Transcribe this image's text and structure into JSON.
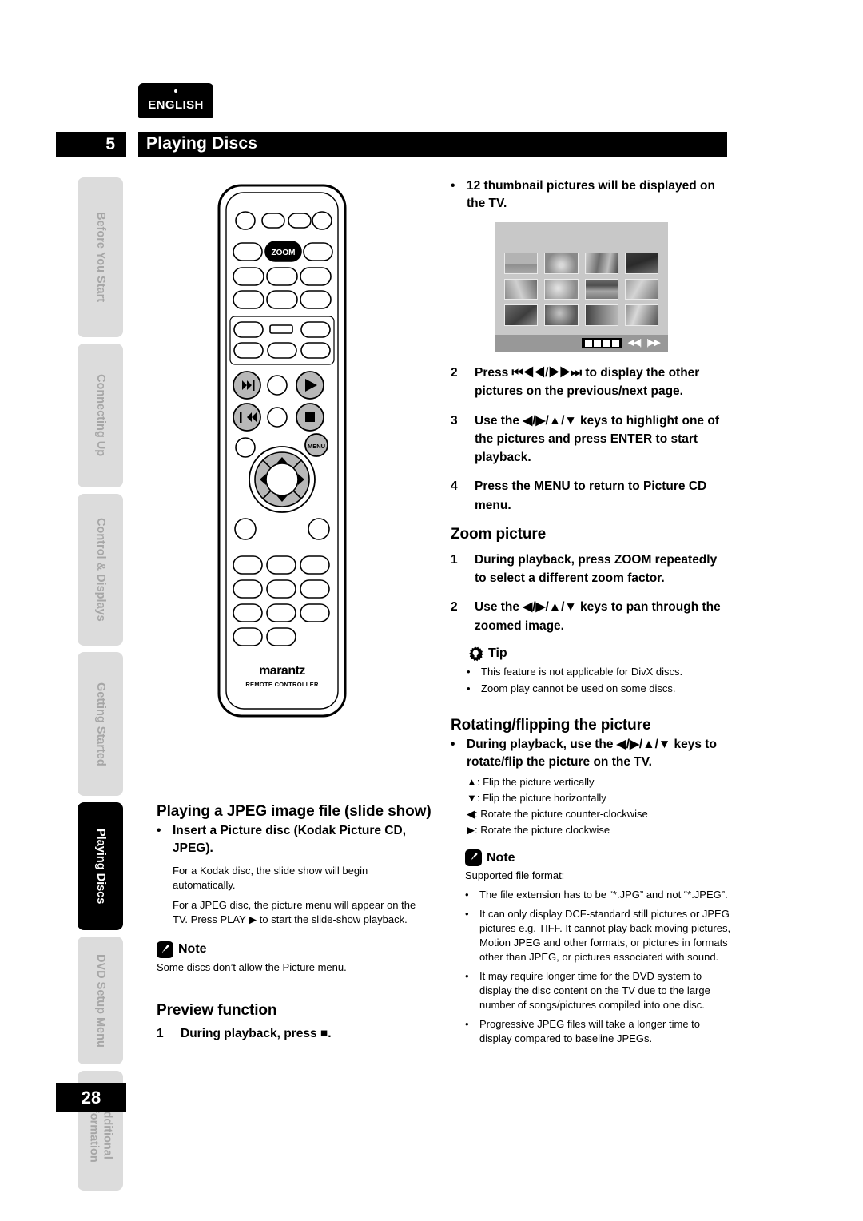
{
  "lang_tab": {
    "label": "ENGLISH"
  },
  "header": {
    "number": "5",
    "title": "Playing Discs"
  },
  "page_number": "28",
  "sidebar": {
    "items": [
      {
        "label": "Before You Start",
        "active": false
      },
      {
        "label": "Connecting Up",
        "active": false
      },
      {
        "label": "Control & Displays",
        "active": false
      },
      {
        "label": "Getting Started",
        "active": false
      },
      {
        "label": "Playing Discs",
        "active": true
      },
      {
        "label": "DVD Setup Menu",
        "active": false
      },
      {
        "label": "Additional\nInformation",
        "active": false
      }
    ]
  },
  "remote": {
    "zoom_button_label": "ZOOM",
    "menu_button_label": "MENU",
    "brand": "marantz",
    "subtitle": "REMOTE CONTROLLER"
  },
  "tv_screen": {
    "thumbnail_count": 12,
    "prev_icon": "skip-previous-icon",
    "next_icon": "skip-next-icon",
    "filmstrip_icon": "filmstrip-icon"
  },
  "left_column": {
    "jpeg_section": {
      "heading": "Playing a JPEG image file (slide show)",
      "bullet": "Insert a Picture disc (Kodak Picture CD, JPEG).",
      "para1": "For a Kodak disc, the slide show will begin automatically.",
      "para2": "For a JPEG disc, the picture menu will appear on the TV. Press PLAY ▶ to start the slide-show playback."
    },
    "note": {
      "label": "Note",
      "body": "Some discs don’t allow the Picture menu."
    },
    "preview_section": {
      "heading": "Preview function",
      "step_num": "1",
      "step_text": "During playback, press ■."
    }
  },
  "right_column": {
    "intro_bullet": "12 thumbnail pictures will be displayed on the TV.",
    "steps": [
      {
        "num": "2",
        "text": "Press ⏮◀◀/▶▶⏭ to display the other pictures on the previous/next page."
      },
      {
        "num": "3",
        "text": "Use the ◀/▶/▲/▼ keys to highlight one of the pictures and press ENTER to start playback."
      },
      {
        "num": "4",
        "text": "Press the MENU to return to Picture CD menu."
      }
    ],
    "zoom_section": {
      "heading": "Zoom picture",
      "steps": [
        {
          "num": "1",
          "text": "During playback, press ZOOM repeatedly to select a different zoom factor."
        },
        {
          "num": "2",
          "text": "Use the ◀/▶/▲/▼ keys to pan through the zoomed image."
        }
      ],
      "tip": {
        "label": "Tip",
        "bullets": [
          "This feature is not applicable for DivX discs.",
          "Zoom play cannot be used on some discs."
        ]
      }
    },
    "rotate_section": {
      "heading": "Rotating/flipping the picture",
      "bullet": "During playback, use the ◀/▶/▲/▼ keys to rotate/flip the picture on the TV.",
      "keys": [
        "▲: Flip the picture vertically",
        "▼: Flip the picture horizontally",
        "◀: Rotate the picture counter-clockwise",
        "▶: Rotate the picture clockwise"
      ],
      "note": {
        "label": "Note",
        "intro": "Supported file format:",
        "bullets": [
          "The file extension has to be “*.JPG” and not “*.JPEG”.",
          "It can only display DCF-standard still pictures or JPEG pictures e.g. TIFF. It cannot play back moving pictures, Motion JPEG and other formats, or pictures in formats other than JPEG, or pictures associated with sound.",
          "It may require longer time for the DVD system to display the disc content on the TV due to the large number of songs/pictures compiled into one disc.",
          "Progressive JPEG files will take a longer time to display compared to baseline JPEGs."
        ]
      }
    }
  }
}
